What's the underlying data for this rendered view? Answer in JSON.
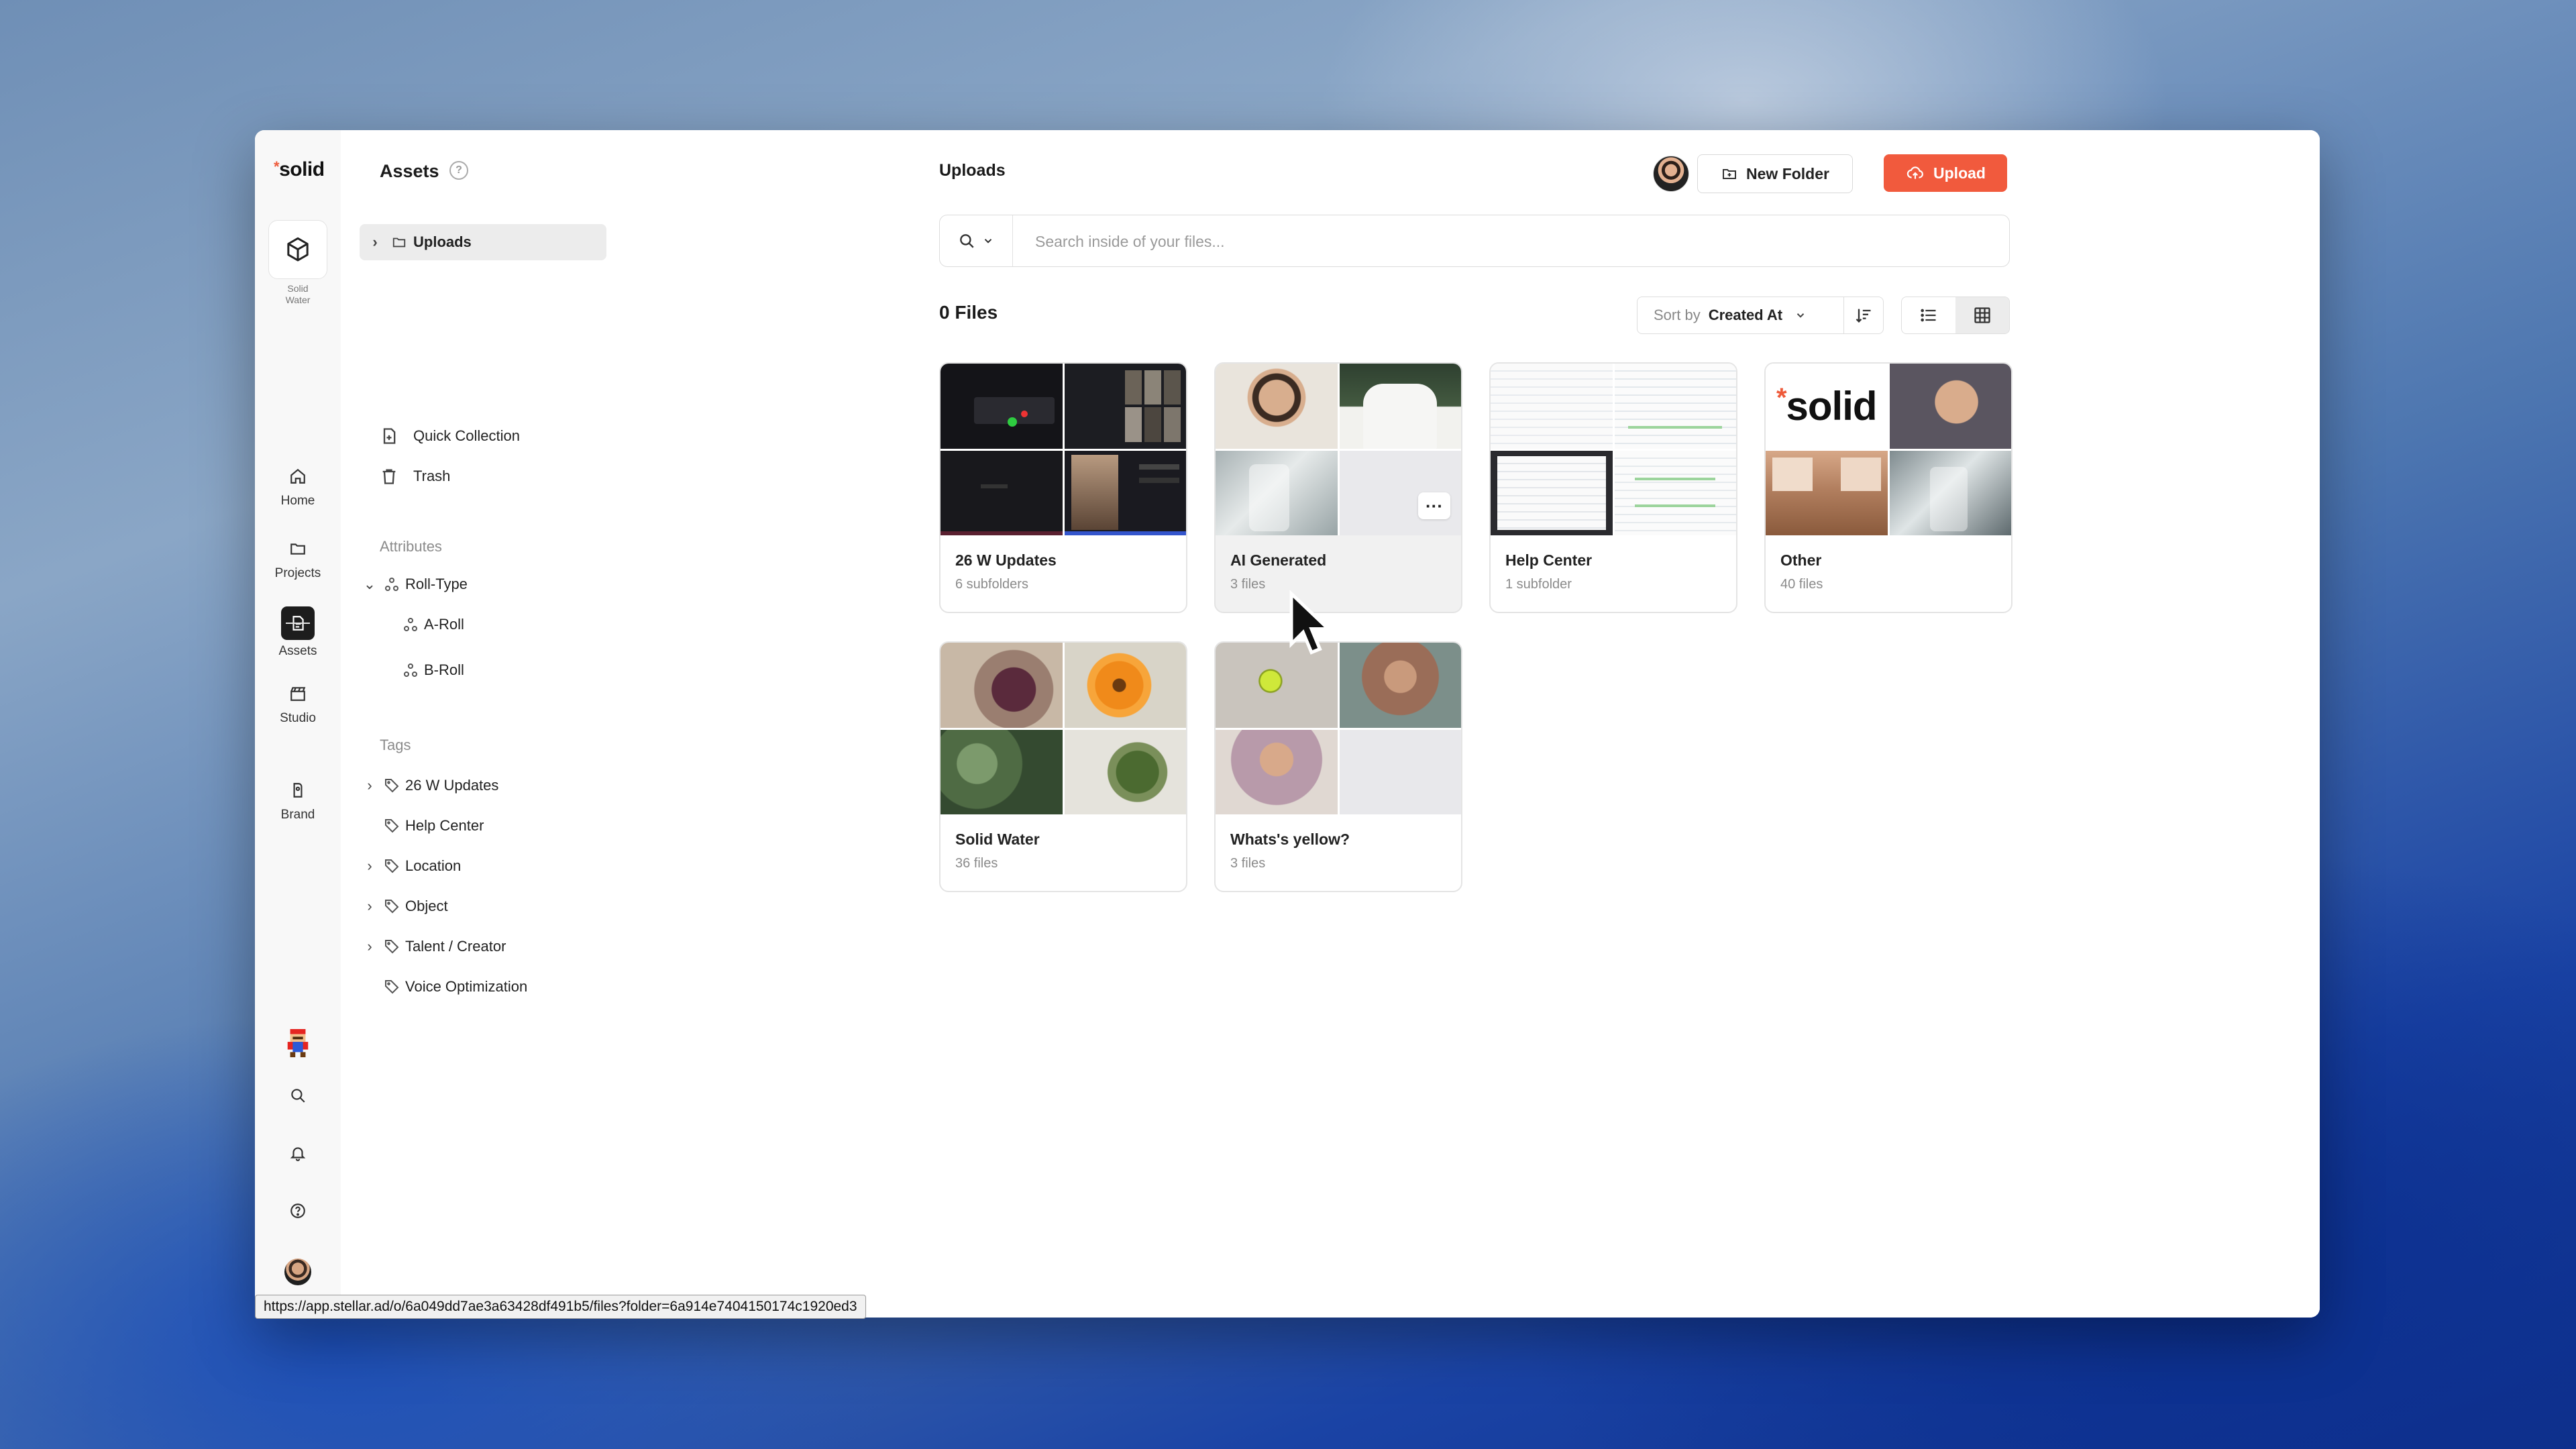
{
  "app": {
    "logo": "solid",
    "workspace_label": "Solid Water"
  },
  "rail": {
    "items": [
      {
        "label": "Home",
        "icon": "home-icon"
      },
      {
        "label": "Projects",
        "icon": "folder-icon"
      },
      {
        "label": "Assets",
        "icon": "assets-icon",
        "active": true
      },
      {
        "label": "Studio",
        "icon": "clapperboard-icon"
      },
      {
        "label": "Brand",
        "icon": "brand-icon"
      }
    ]
  },
  "sidebar": {
    "title": "Assets",
    "uploads_label": "Uploads",
    "quick_collection": "Quick Collection",
    "trash": "Trash",
    "attributes_label": "Attributes",
    "roll_type": "Roll-Type",
    "a_roll": "A-Roll",
    "b_roll": "B-Roll",
    "tags_label": "Tags",
    "tags": [
      "26 W Updates",
      "Help Center",
      "Location",
      "Object",
      "Talent / Creator",
      "Voice Optimization"
    ]
  },
  "main": {
    "title": "Uploads",
    "new_folder": "New Folder",
    "upload": "Upload",
    "search_placeholder": "Search inside of your files...",
    "file_count": "0 Files",
    "sort_label": "Sort by",
    "sort_value": "Created At"
  },
  "folders": [
    {
      "name": "26 W Updates",
      "meta": "6 subfolders"
    },
    {
      "name": "AI Generated",
      "meta": "3 files"
    },
    {
      "name": "Help Center",
      "meta": "1 subfolder"
    },
    {
      "name": "Other",
      "meta": "40 files"
    },
    {
      "name": "Solid Water",
      "meta": "36 files"
    },
    {
      "name": "Whats's yellow?",
      "meta": "3 files"
    }
  ],
  "thumb_text": {
    "solid_logo": "solid"
  },
  "status_url": "https://app.stellar.ad/o/6a049dd7ae3a63428df491b5/files?folder=6a914e7404150174c1920ed3",
  "colors": {
    "accent": "#f15a3d",
    "active_rail": "#1d1d1d"
  }
}
